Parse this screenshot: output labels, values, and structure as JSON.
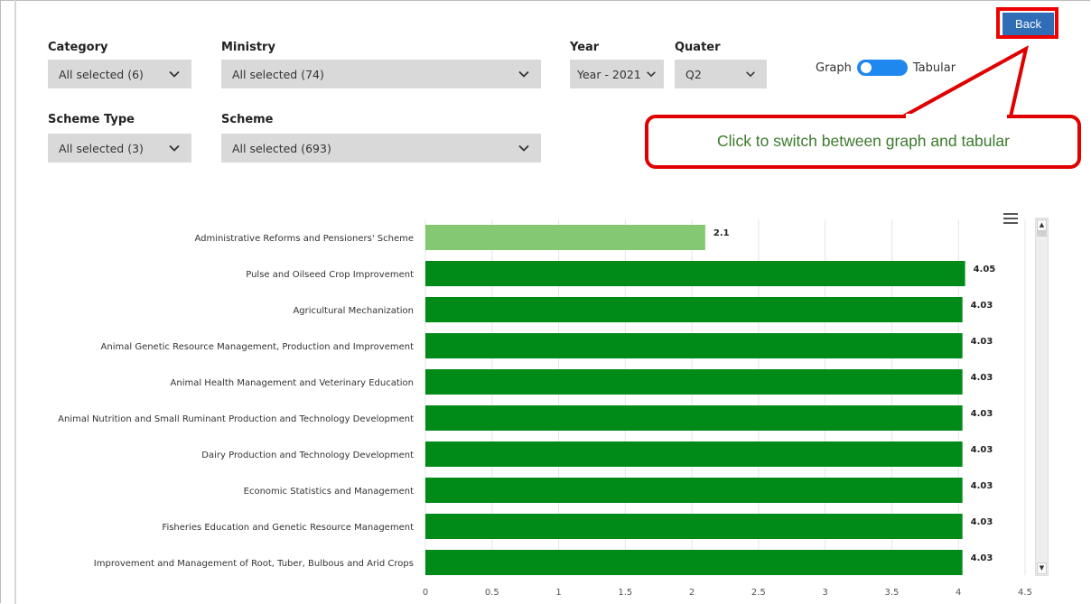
{
  "filters": {
    "category": {
      "label": "Category",
      "value": "All selected (6)"
    },
    "ministry": {
      "label": "Ministry",
      "value": "All selected (74)"
    },
    "year": {
      "label": "Year",
      "value": "Year - 2021"
    },
    "quarter": {
      "label": "Quater",
      "value": "Q2"
    },
    "scheme_type": {
      "label": "Scheme Type",
      "value": "All selected (3)"
    },
    "scheme": {
      "label": "Scheme",
      "value": "All selected (693)"
    }
  },
  "view_toggle": {
    "left_label": "Graph",
    "right_label": "Tabular"
  },
  "back_button": "Back",
  "callout": "Click to switch between graph and tabular",
  "icons": {
    "dropdown": "chevron-down-icon",
    "chart_menu": "hamburger-menu-icon"
  },
  "colors": {
    "bar_highlight": "#85c872",
    "bar": "#008a17",
    "callout_border": "#e00000",
    "back_button": "#2f6eb7",
    "toggle": "#1e88ef"
  },
  "chart_data": {
    "type": "bar",
    "orientation": "horizontal",
    "categories": [
      "Administrative Reforms and Pensioners' Scheme",
      "Pulse and Oilseed Crop Improvement",
      "Agricultural Mechanization",
      "Animal Genetic Resource Management, Production and Improvement",
      "Animal Health Management and Veterinary Education",
      "Animal Nutrition and Small Ruminant Production and Technology Development",
      "Dairy Production and Technology Development",
      "Economic Statistics and Management",
      "Fisheries Education and Genetic Resource Management",
      "Improvement and Management of Root, Tuber, Bulbous and Arid Crops"
    ],
    "values": [
      2.1,
      4.05,
      4.03,
      4.03,
      4.03,
      4.03,
      4.03,
      4.03,
      4.03,
      4.03
    ],
    "data_labels": [
      "2.1",
      "4.05",
      "4.03",
      "4.03",
      "4.03",
      "4.03",
      "4.03",
      "4.03",
      "4.03",
      "4.03"
    ],
    "xlim": [
      0,
      4.5
    ],
    "x_ticks": [
      "0",
      "0.5",
      "1",
      "1.5",
      "2",
      "2.5",
      "3",
      "3.5",
      "4",
      "4.5"
    ],
    "grid": true,
    "title": "",
    "xlabel": "",
    "ylabel": ""
  }
}
